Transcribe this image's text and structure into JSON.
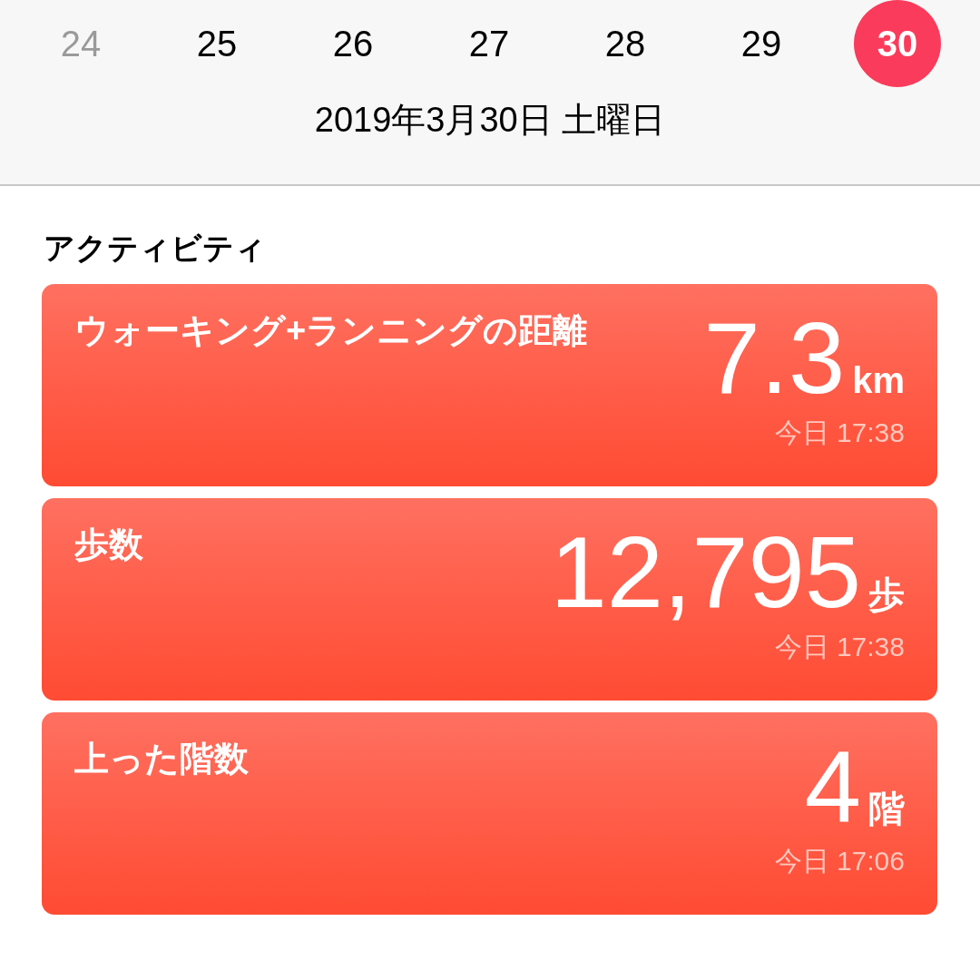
{
  "days": [
    {
      "label": "24",
      "muted": true,
      "selected": false
    },
    {
      "label": "25",
      "muted": false,
      "selected": false
    },
    {
      "label": "26",
      "muted": false,
      "selected": false
    },
    {
      "label": "27",
      "muted": false,
      "selected": false
    },
    {
      "label": "28",
      "muted": false,
      "selected": false
    },
    {
      "label": "29",
      "muted": false,
      "selected": false
    },
    {
      "label": "30",
      "muted": false,
      "selected": true
    }
  ],
  "date": "2019年3月30日 土曜日",
  "section_title": "アクティビティ",
  "cards": [
    {
      "title": "ウォーキング+ランニングの距離",
      "value": "7.3",
      "unit": "km",
      "time": "今日 17:38"
    },
    {
      "title": "歩数",
      "value": "12,795",
      "unit": "歩",
      "time": "今日 17:38"
    },
    {
      "title": "上った階数",
      "value": "4",
      "unit": "階",
      "time": "今日 17:06"
    }
  ]
}
